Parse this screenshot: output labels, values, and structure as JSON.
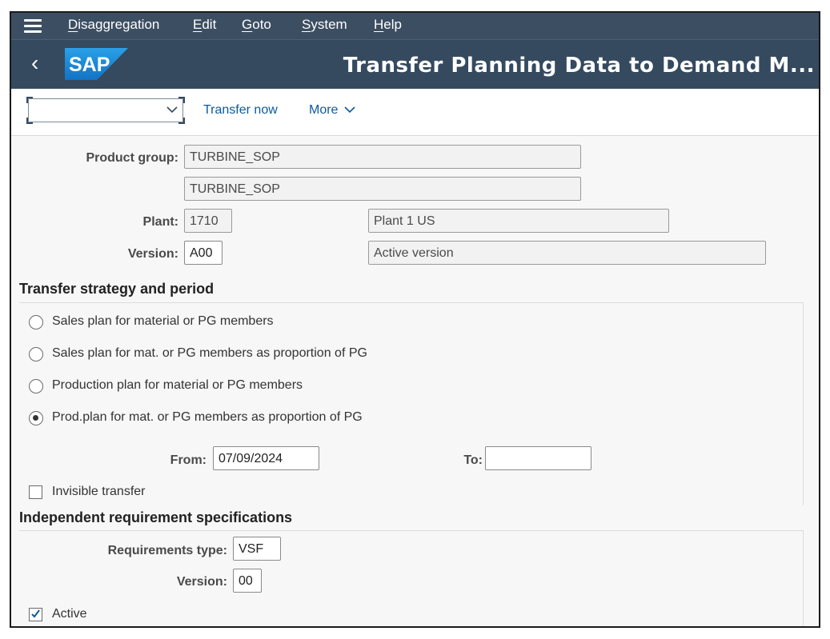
{
  "menu": {
    "items": [
      {
        "label": "Disaggregation",
        "mnemonic": "D",
        "rest": "isaggregation"
      },
      {
        "label": "Edit",
        "mnemonic": "E",
        "rest": "dit"
      },
      {
        "label": "Goto",
        "mnemonic": "G",
        "rest": "oto"
      },
      {
        "label": "System",
        "mnemonic": "S",
        "rest": "ystem"
      },
      {
        "label": "Help",
        "mnemonic": "H",
        "rest": "elp"
      }
    ]
  },
  "shell": {
    "back_glyph": "‹",
    "logo_text": "SAP",
    "title": "Transfer Planning Data to Demand M..."
  },
  "toolbar": {
    "command_value": "",
    "transfer_now": "Transfer now",
    "more": "More"
  },
  "header": {
    "product_group_label": "Product group:",
    "product_group_value": "TURBINE_SOP",
    "product_group_desc": "TURBINE_SOP",
    "plant_label": "Plant:",
    "plant_value": "1710",
    "plant_desc": "Plant 1 US",
    "version_label": "Version:",
    "version_value": "A00",
    "version_desc": "Active version"
  },
  "transfer": {
    "title": "Transfer strategy and period",
    "options": [
      {
        "label": "Sales plan for material or PG members",
        "selected": false
      },
      {
        "label": "Sales plan for mat. or PG members as proportion of PG",
        "selected": false
      },
      {
        "label": "Production plan for material or PG members",
        "selected": false
      },
      {
        "label": "Prod.plan for mat. or PG members as proportion of PG",
        "selected": true
      }
    ],
    "from_label": "From:",
    "from_value": "07/09/2024",
    "to_label": "To:",
    "to_value": "",
    "invisible_label": "Invisible transfer",
    "invisible_checked": false
  },
  "requirements": {
    "title": "Independent requirement specifications",
    "type_label": "Requirements type:",
    "type_value": "VSF",
    "version_label": "Version:",
    "version_value": "00",
    "active_label": "Active",
    "active_checked": true
  },
  "colors": {
    "menubar": "#3c4e62",
    "shell": "#354a5f",
    "link": "#0a5a9e",
    "sap_blue": "#1d8cd6"
  }
}
